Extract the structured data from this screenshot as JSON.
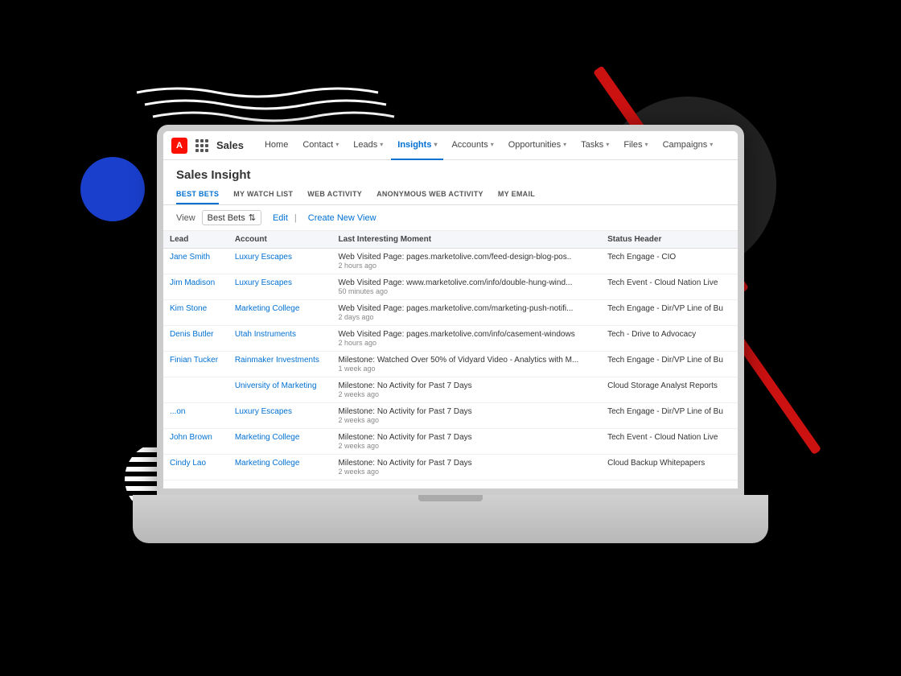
{
  "background": {
    "colors": {
      "main": "#000000",
      "blue_circle": "#1a3fcc",
      "dark_circle": "#222222",
      "red_stripe": "#cc1111"
    }
  },
  "app": {
    "logo_letter": "A",
    "app_name": "Sales",
    "nav_items": [
      {
        "label": "Home",
        "has_chevron": false,
        "active": false
      },
      {
        "label": "Contact",
        "has_chevron": true,
        "active": false
      },
      {
        "label": "Leads",
        "has_chevron": true,
        "active": false
      },
      {
        "label": "Insights",
        "has_chevron": true,
        "active": true
      },
      {
        "label": "Accounts",
        "has_chevron": true,
        "active": false
      },
      {
        "label": "Opportunities",
        "has_chevron": true,
        "active": false
      },
      {
        "label": "Tasks",
        "has_chevron": true,
        "active": false
      },
      {
        "label": "Files",
        "has_chevron": true,
        "active": false
      },
      {
        "label": "Campaigns",
        "has_chevron": true,
        "active": false
      }
    ]
  },
  "page": {
    "title": "Sales Insight",
    "tabs": [
      {
        "label": "BEST BETS",
        "active": true
      },
      {
        "label": "MY WATCH LIST",
        "active": false
      },
      {
        "label": "WEB ACTIVITY",
        "active": false
      },
      {
        "label": "ANONYMOUS WEB ACTIVITY",
        "active": false
      },
      {
        "label": "MY EMAIL",
        "active": false
      }
    ],
    "view_label": "View",
    "view_value": "Best Bets",
    "edit_label": "Edit",
    "separator": "|",
    "create_view_label": "Create New View",
    "table": {
      "columns": [
        "Lead",
        "Account",
        "Last Interesting Moment",
        "Status Header"
      ],
      "rows": [
        {
          "lead": "Jane Smith",
          "account": "Luxury Escapes",
          "moment": "Web Visited Page: pages.marketolive.com/feed-design-blog-pos..",
          "moment_time": "2 hours ago",
          "status": "Tech Engage - CIO"
        },
        {
          "lead": "Jim Madison",
          "account": "Luxury Escapes",
          "moment": "Web Visited Page: www.marketolive.com/info/double-hung-wind...",
          "moment_time": "50 minutes ago",
          "status": "Tech Event - Cloud Nation Live"
        },
        {
          "lead": "Kim Stone",
          "account": "Marketing College",
          "moment": "Web Visited Page: pages.marketolive.com/marketing-push-notifi...",
          "moment_time": "2 days ago",
          "status": "Tech Engage - Dir/VP Line of Bu"
        },
        {
          "lead": "Denis Butler",
          "account": "Utah Instruments",
          "moment": "Web Visited Page: pages.marketolive.com/info/casement-windows",
          "moment_time": "2 hours ago",
          "status": "Tech - Drive to Advocacy"
        },
        {
          "lead": "Finian Tucker",
          "account": "Rainmaker Investments",
          "moment": "Milestone: Watched Over 50% of Vidyard Video - Analytics with M...",
          "moment_time": "1 week ago",
          "status": "Tech Engage - Dir/VP Line of Bu"
        },
        {
          "lead": "",
          "account": "University of Marketing",
          "moment": "Milestone: No Activity for Past 7 Days",
          "moment_time": "2 weeks ago",
          "status": "Cloud Storage Analyst Reports"
        },
        {
          "lead": "...on",
          "account": "Luxury Escapes",
          "moment": "Milestone: No Activity for Past 7 Days",
          "moment_time": "2 weeks ago",
          "status": "Tech Engage - Dir/VP Line of Bu"
        },
        {
          "lead": "John Brown",
          "account": "Marketing College",
          "moment": "Milestone: No Activity for Past 7 Days",
          "moment_time": "2 weeks ago",
          "status": "Tech Event - Cloud Nation Live"
        },
        {
          "lead": "Cindy Lao",
          "account": "Marketing College",
          "moment": "Milestone: No Activity for Past 7 Days",
          "moment_time": "2 weeks ago",
          "status": "Cloud Backup Whitepapers"
        }
      ]
    }
  }
}
